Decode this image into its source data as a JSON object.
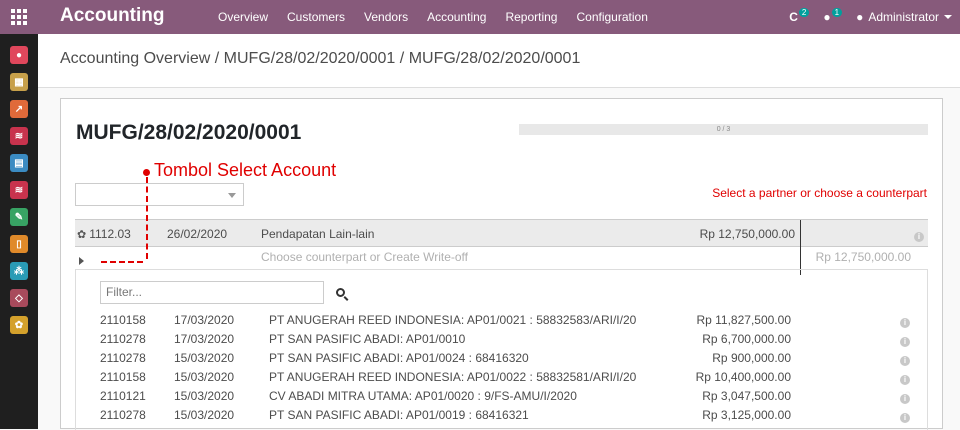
{
  "app": {
    "title": "Accounting"
  },
  "menu": [
    "Overview",
    "Customers",
    "Vendors",
    "Accounting",
    "Reporting",
    "Configuration"
  ],
  "systray": {
    "activity_count": "2",
    "message_count": "1",
    "user": "Administrator"
  },
  "breadcrumb": {
    "root": "Accounting Overview",
    "sep": "/",
    "middle": "MUFG/28/02/2020/0001",
    "current": "MUFG/28/02/2020/0001"
  },
  "statement": {
    "title": "MUFG/28/02/2020/0001",
    "progress": "0 / 3",
    "progress_value": 0,
    "hint": "Select a partner or choose a counterpart",
    "annotation": "Tombol Select Account",
    "line": {
      "account": "1112.03",
      "date": "26/02/2020",
      "label": "Pendapatan Lain-lain",
      "amount": "Rp 12,750,000.00"
    },
    "counterpart": {
      "placeholder": "Choose counterpart or Create Write-off",
      "amount": "Rp 12,750,000.00"
    }
  },
  "filter": {
    "placeholder": "Filter..."
  },
  "candidates": [
    {
      "account": "2110158",
      "date": "17/03/2020",
      "label": "PT ANUGERAH REED INDONESIA: AP01/0021 : 58832583/ARI/I/20",
      "amount": "Rp 11,827,500.00"
    },
    {
      "account": "2110278",
      "date": "17/03/2020",
      "label": "PT SAN PASIFIC ABADI: AP01/0010",
      "amount": "Rp 6,700,000.00"
    },
    {
      "account": "2110278",
      "date": "15/03/2020",
      "label": "PT SAN PASIFIC ABADI: AP01/0024 : 68416320",
      "amount": "Rp 900,000.00"
    },
    {
      "account": "2110158",
      "date": "15/03/2020",
      "label": "PT ANUGERAH REED INDONESIA: AP01/0022 : 58832581/ARI/I/20",
      "amount": "Rp 10,400,000.00"
    },
    {
      "account": "2110121",
      "date": "15/03/2020",
      "label": "CV ABADI MITRA UTAMA: AP01/0020 : 9/FS-AMU/I/2020",
      "amount": "Rp 3,047,500.00"
    },
    {
      "account": "2110278",
      "date": "15/03/2020",
      "label": "PT SAN PASIFIC ABADI: AP01/0019 : 68416321",
      "amount": "Rp 3,125,000.00"
    }
  ],
  "sidebar_icons": [
    {
      "name": "discuss-icon",
      "color": "#e0475c"
    },
    {
      "name": "calendar-icon",
      "color": "#c7a04a"
    },
    {
      "name": "chart-icon",
      "color": "#e06a3a"
    },
    {
      "name": "inbox-icon",
      "color": "#c8334d"
    },
    {
      "name": "invoice-icon",
      "color": "#3b8bc2"
    },
    {
      "name": "inbox-icon",
      "color": "#c8334d"
    },
    {
      "name": "wrench-icon",
      "color": "#38a364"
    },
    {
      "name": "document-icon",
      "color": "#e08a2a"
    },
    {
      "name": "users-icon",
      "color": "#2a9bb5"
    },
    {
      "name": "apps-icon",
      "color": "#a84a5c"
    },
    {
      "name": "settings-icon",
      "color": "#d4a12c"
    }
  ]
}
